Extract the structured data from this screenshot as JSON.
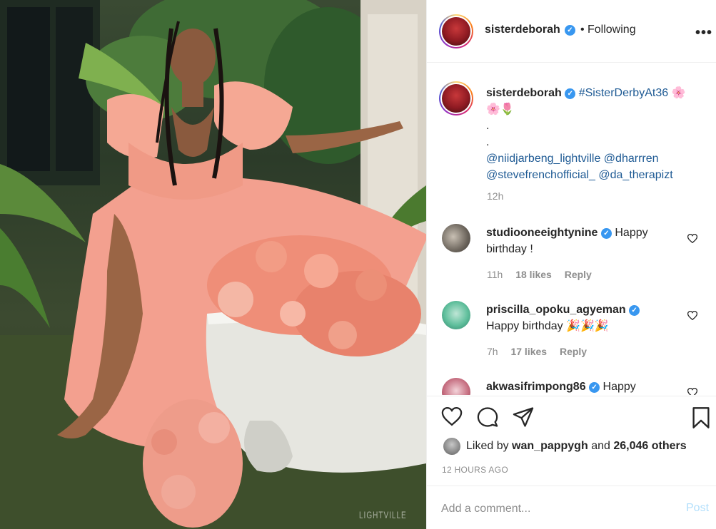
{
  "header": {
    "username": "sisterdeborah",
    "separator": "•",
    "follow_status": "Following",
    "more_icon": "more-horizontal-icon"
  },
  "caption": {
    "username": "sisterdeborah",
    "hashtag": "#SisterDerbyAt36",
    "emoji_line_1": "🌸",
    "emoji_line_2": "🌸🌷",
    "dot_1": ".",
    "dot_2": ".",
    "mention_1": "@niidjarbeng_lightville",
    "mention_2": "@dharrren",
    "mention_3": "@stevefrenchofficial_",
    "mention_4": "@da_therapizt",
    "time": "12h"
  },
  "comments": [
    {
      "username": "studiooneeightynine",
      "text_line_1": "Happy",
      "text_line_2": "birthday !",
      "time": "11h",
      "likes": "18 likes",
      "reply": "Reply"
    },
    {
      "username": "priscilla_opoku_agyeman",
      "text_line_1": "Happy birthday 🎉🎉🎉",
      "time": "7h",
      "likes": "17 likes",
      "reply": "Reply"
    },
    {
      "username": "akwasifrimpong86",
      "text_line_1": "Happy"
    }
  ],
  "actions": {
    "like_icon": "heart-icon",
    "comment_icon": "comment-icon",
    "share_icon": "send-icon",
    "save_icon": "bookmark-icon"
  },
  "likes": {
    "prefix": "Liked by",
    "user": "wan_pappygh",
    "middle": "and",
    "others": "26,046 others"
  },
  "timestamp": "12 HOURS AGO",
  "add_comment": {
    "placeholder": "Add a comment...",
    "post_label": "Post"
  },
  "photo": {
    "watermark": "LIGHTVILLE"
  },
  "colors": {
    "verified": "#3897f0",
    "link": "#1e5a94",
    "post_disabled": "#b2dffc",
    "muted": "#8e8e8e"
  }
}
